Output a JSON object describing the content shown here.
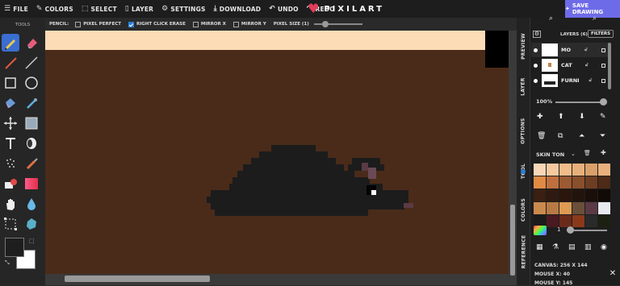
{
  "menu": {
    "items": [
      {
        "label": "FILE",
        "icon": "menu-icon",
        "glyph": "☰"
      },
      {
        "label": "COLORS",
        "icon": "brush-icon",
        "glyph": "✎"
      },
      {
        "label": "SELECT",
        "icon": "select-icon",
        "glyph": "⬚"
      },
      {
        "label": "LAYER",
        "icon": "file-icon",
        "glyph": "▯"
      },
      {
        "label": "SETTINGS",
        "icon": "gear-icon",
        "glyph": "⚙"
      },
      {
        "label": "DOWNLOAD",
        "icon": "download-icon",
        "glyph": "⤓"
      },
      {
        "label": "UNDO",
        "icon": "undo-icon",
        "glyph": "↶"
      },
      {
        "label": "REDO",
        "icon": "redo-icon",
        "glyph": "↷"
      }
    ],
    "logo": "PIXILART",
    "save": "SAVE DRAWING"
  },
  "toolbar": {
    "title": "TOOLS",
    "primary_color": "#1e1e1e",
    "secondary_color": "#ffffff"
  },
  "options": {
    "tool": "PENCIL:",
    "pixel_perfect": "PIXEL PERFECT",
    "pixel_perfect_checked": false,
    "right_click_erase": "RIGHT CLICK ERASE",
    "right_click_erase_checked": true,
    "mirror_x": "MIRROR X",
    "mirror_x_checked": false,
    "mirror_y": "MIRROR Y",
    "mirror_y_checked": false,
    "pixel_size": "PIXEL SIZE (1)"
  },
  "canvas": {
    "sky_color": "#fcdcb6",
    "ground_color": "#4a2b19",
    "mouse_color": "#1c1c1c"
  },
  "tabs": [
    "PREVIEW",
    "LAYER",
    "OPTIONS",
    "TOOL",
    "COLORS",
    "REFERENCE"
  ],
  "layers": {
    "header": "LAYERS (6)",
    "filters": "FILTERS",
    "items": [
      {
        "name": "MO"
      },
      {
        "name": "CAT"
      },
      {
        "name": "FURNI"
      }
    ],
    "opacity": "100%"
  },
  "colors": {
    "palette_name": "SKIN TON",
    "swatches": [
      "#f9d7b6",
      "#f7c9a0",
      "#f1bb8a",
      "#e7b07a",
      "#d9a06a",
      "#e9b07e",
      "#e08a44",
      "#c07040",
      "#9b5a32",
      "#8a4f2b",
      "#6e3e22",
      "#4e2a17",
      "#3a1f12",
      "#2e1a10",
      "#2a160d",
      "#22140c",
      "#1a0f09",
      "#120a06",
      "#c98a4e",
      "#b87a44",
      "#dd9b53",
      "#6a4f3a",
      "#5a3a44",
      "#e8eaf0",
      "#1b1b1b",
      "#4a1a22",
      "#6a2a1a",
      "#8a3a1a",
      "#2a2a2a",
      "#1c2010"
    ],
    "brush_size": "1"
  },
  "stats": {
    "canvas": "CANVAS: 256 X 144",
    "mouse_x": "MOUSE X: 40",
    "mouse_y": "MOUSE Y: 145"
  }
}
